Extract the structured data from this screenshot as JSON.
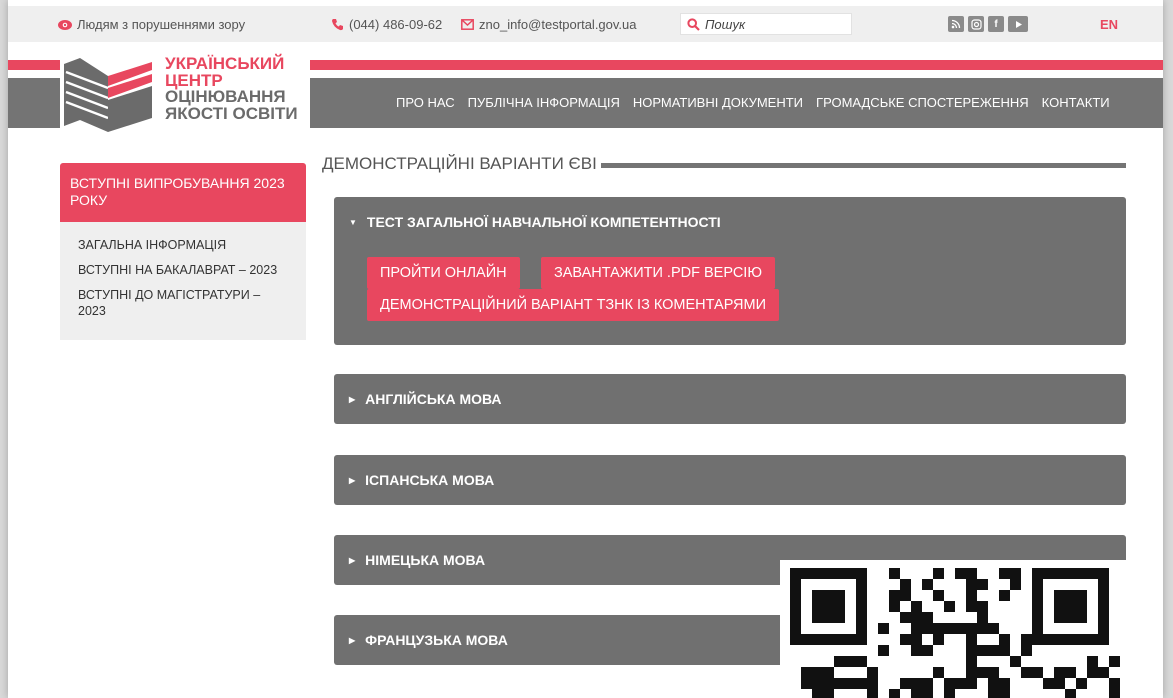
{
  "topbar": {
    "vision_label": "Людям з порушеннями зору",
    "phone": "(044) 486-09-62",
    "email": "zno_info@testportal.gov.ua",
    "search_placeholder": "Пошук",
    "language": "EN",
    "social_icons": [
      "rss-icon",
      "instagram-icon",
      "facebook-icon",
      "youtube-icon"
    ]
  },
  "logo": {
    "line1": "УКРАЇНСЬКИЙ",
    "line2": "ЦЕНТР",
    "line3": "ОЦІНЮВАННЯ",
    "line4": "ЯКОСТІ ОСВІТИ"
  },
  "nav": [
    "ПРО НАС",
    "ПУБЛІЧНА ІНФОРМАЦІЯ",
    "НОРМАТИВНІ ДОКУМЕНТИ",
    "ГРОМАДСЬКЕ СПОСТЕРЕЖЕННЯ",
    "КОНТАКТИ"
  ],
  "sidebar": {
    "heading": "ВСТУПНІ ВИПРОБУВАННЯ 2023 РОКУ",
    "links": [
      "ЗАГАЛЬНА ІНФОРМАЦІЯ",
      "ВСТУПНІ НА БАКАЛАВРАТ – 2023",
      "ВСТУПНІ ДО МАГІСТРАТУРИ – 2023"
    ]
  },
  "main": {
    "title": "ДЕМОНСТРАЦІЙНІ ВАРІАНТИ ЄВІ",
    "accordion": [
      {
        "label": "ТЕСТ ЗАГАЛЬНОЇ НАВЧАЛЬНОЇ КОМПЕТЕНТНОСТІ",
        "expanded": true,
        "buttons": [
          "ПРОЙТИ ОНЛАЙН",
          "ЗАВАНТАЖИТИ .PDF ВЕРСІЮ",
          "ДЕМОНСТРАЦІЙНИЙ ВАРІАНТ ТЗНК ІЗ КОМЕНТАРЯМИ"
        ]
      },
      {
        "label": "АНГЛІЙСЬКА МОВА",
        "expanded": false
      },
      {
        "label": "ІСПАНСЬКА МОВА",
        "expanded": false
      },
      {
        "label": "НІМЕЦЬКА МОВА",
        "expanded": false
      },
      {
        "label": "ФРАНЦУЗЬКА МОВА",
        "expanded": false
      }
    ]
  },
  "colors": {
    "accent_red": "#e8475f",
    "panel_grey": "#707070",
    "light_grey": "#efefef"
  }
}
